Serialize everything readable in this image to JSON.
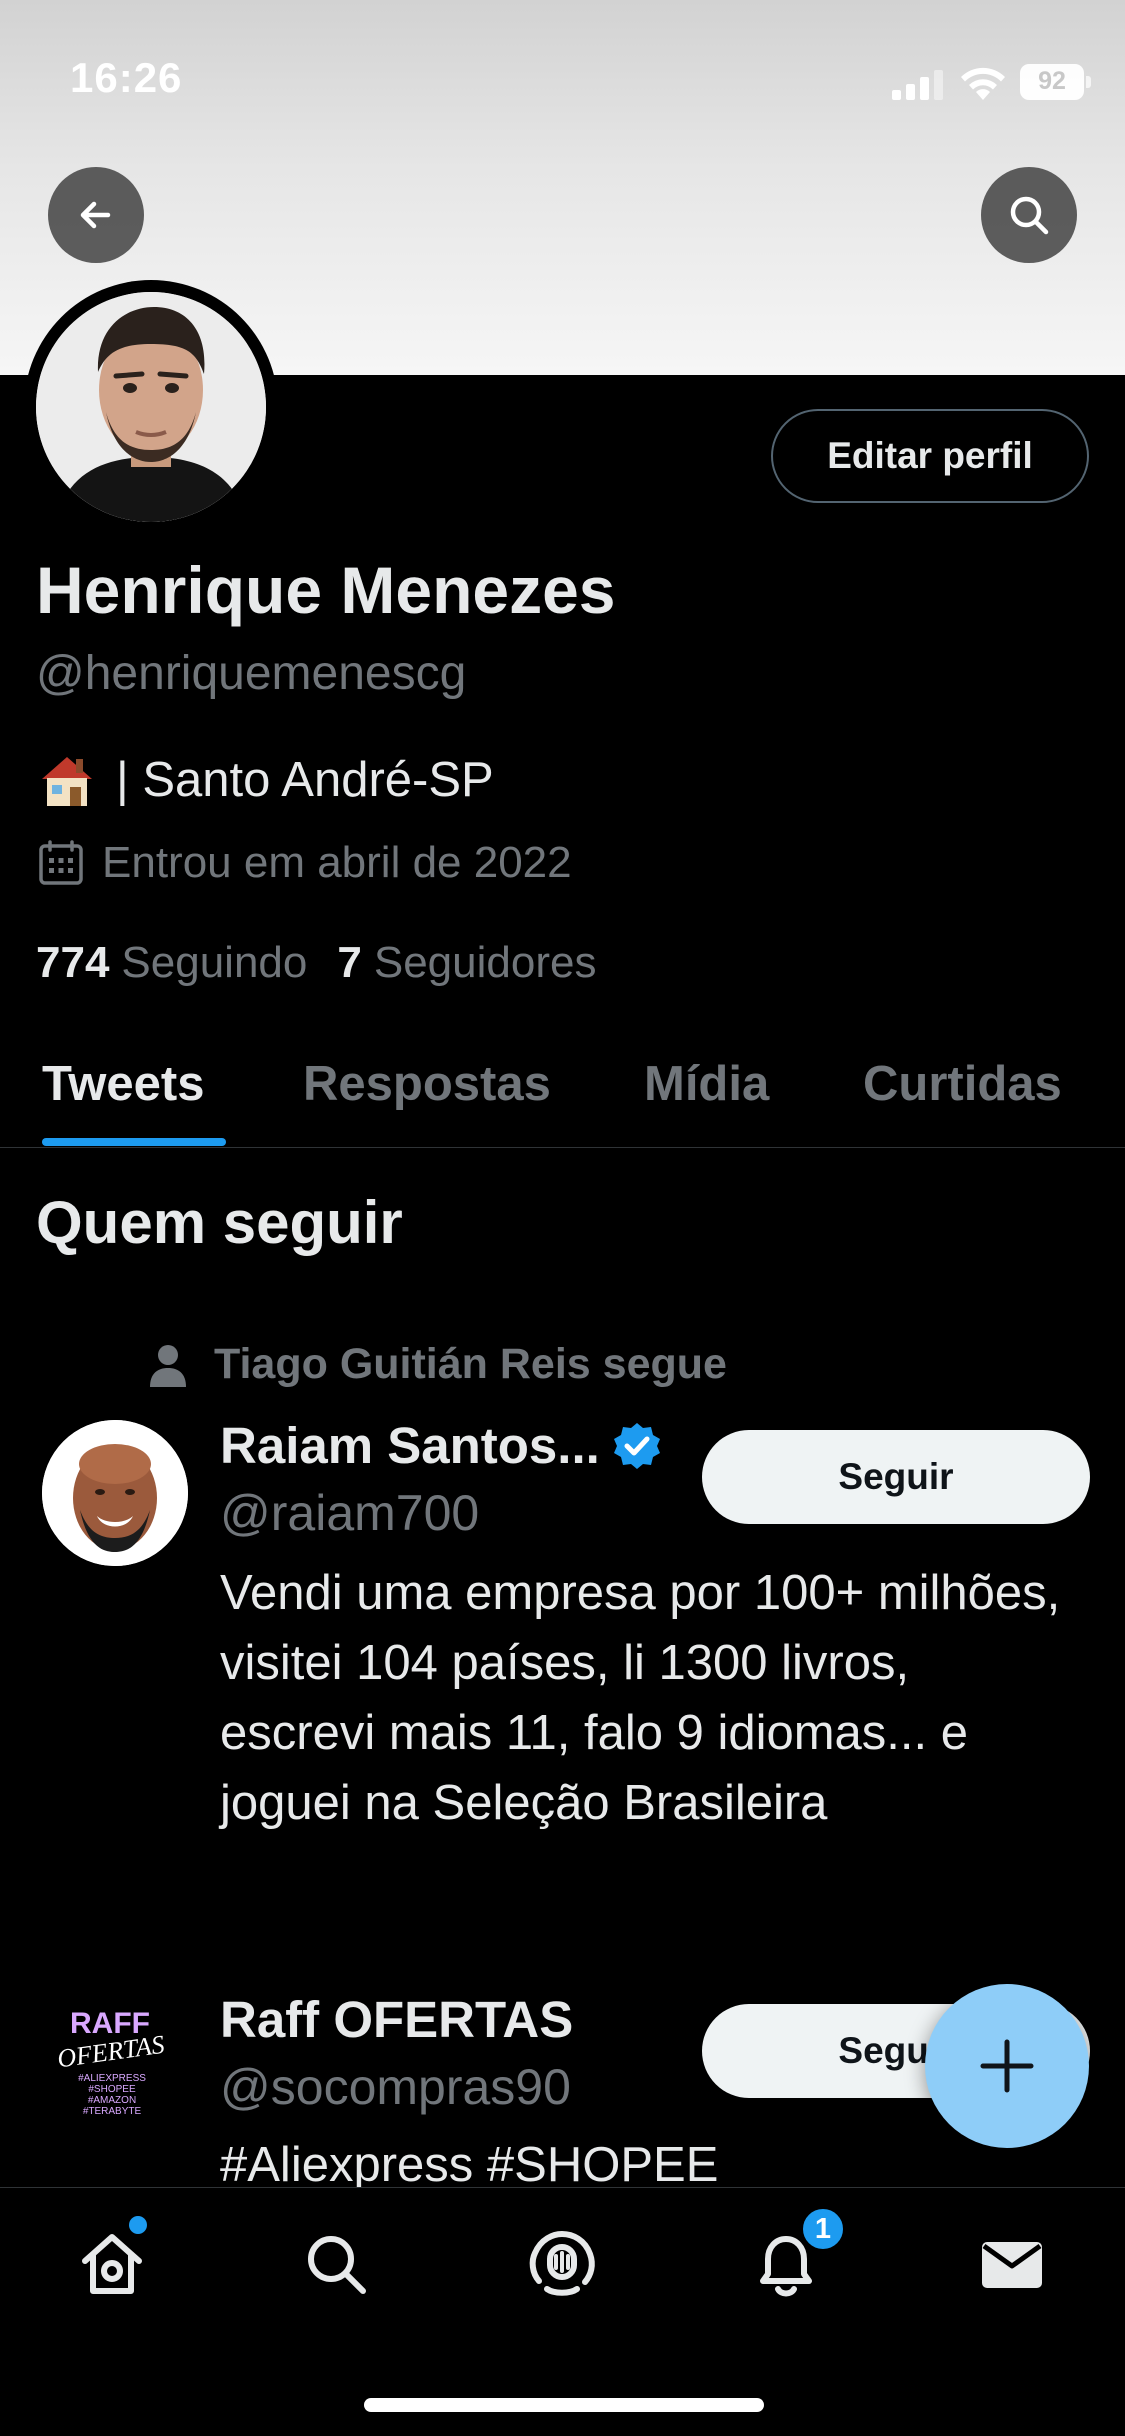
{
  "status_bar": {
    "time": "16:26",
    "battery": "92"
  },
  "profile": {
    "name": "Henrique Menezes",
    "handle": "@henriquemenescg",
    "bio_emoji": "house-emoji",
    "bio_text": "| Santo André-SP",
    "joined": "Entrou em abril de 2022",
    "following_count": "774",
    "following_label": "Seguindo",
    "followers_count": "7",
    "followers_label": "Seguidores",
    "edit_label": "Editar perfil"
  },
  "tabs": [
    {
      "label": "Tweets",
      "active": true
    },
    {
      "label": "Respostas",
      "active": false
    },
    {
      "label": "Mídia",
      "active": false
    },
    {
      "label": "Curtidas",
      "active": false
    }
  ],
  "who_to_follow": {
    "title": "Quem seguir",
    "suggestions": [
      {
        "context": "Tiago Guitián Reis segue",
        "name": "Raiam Santos...",
        "verified": true,
        "handle": "@raiam700",
        "bio": "Vendi uma empresa por 100+ milhões, visitei 104 países, li 1300 livros, escrevi mais 11, falo 9 idiomas... e joguei na Seleção Brasileira",
        "follow_label": "Seguir"
      },
      {
        "name": "Raff OFERTAS",
        "handle": "@socompras90",
        "bio": "#Aliexpress #SHOPEE",
        "follow_label": "Seguir",
        "avatar_text": [
          "RAFF",
          "OFERTAS",
          "#ALIEXPRESS",
          "#SHOPEE",
          "#AMAZON",
          "#TERABYTE"
        ]
      }
    ]
  },
  "bottom_nav": {
    "items": [
      "home-icon",
      "search-icon",
      "spaces-icon",
      "notifications-icon",
      "messages-icon"
    ],
    "notification_count": "1"
  },
  "colors": {
    "accent": "#1d9bf0",
    "fab": "#8ecdf8",
    "muted": "#71767b",
    "text": "#e7e9ea",
    "background": "#000000"
  }
}
